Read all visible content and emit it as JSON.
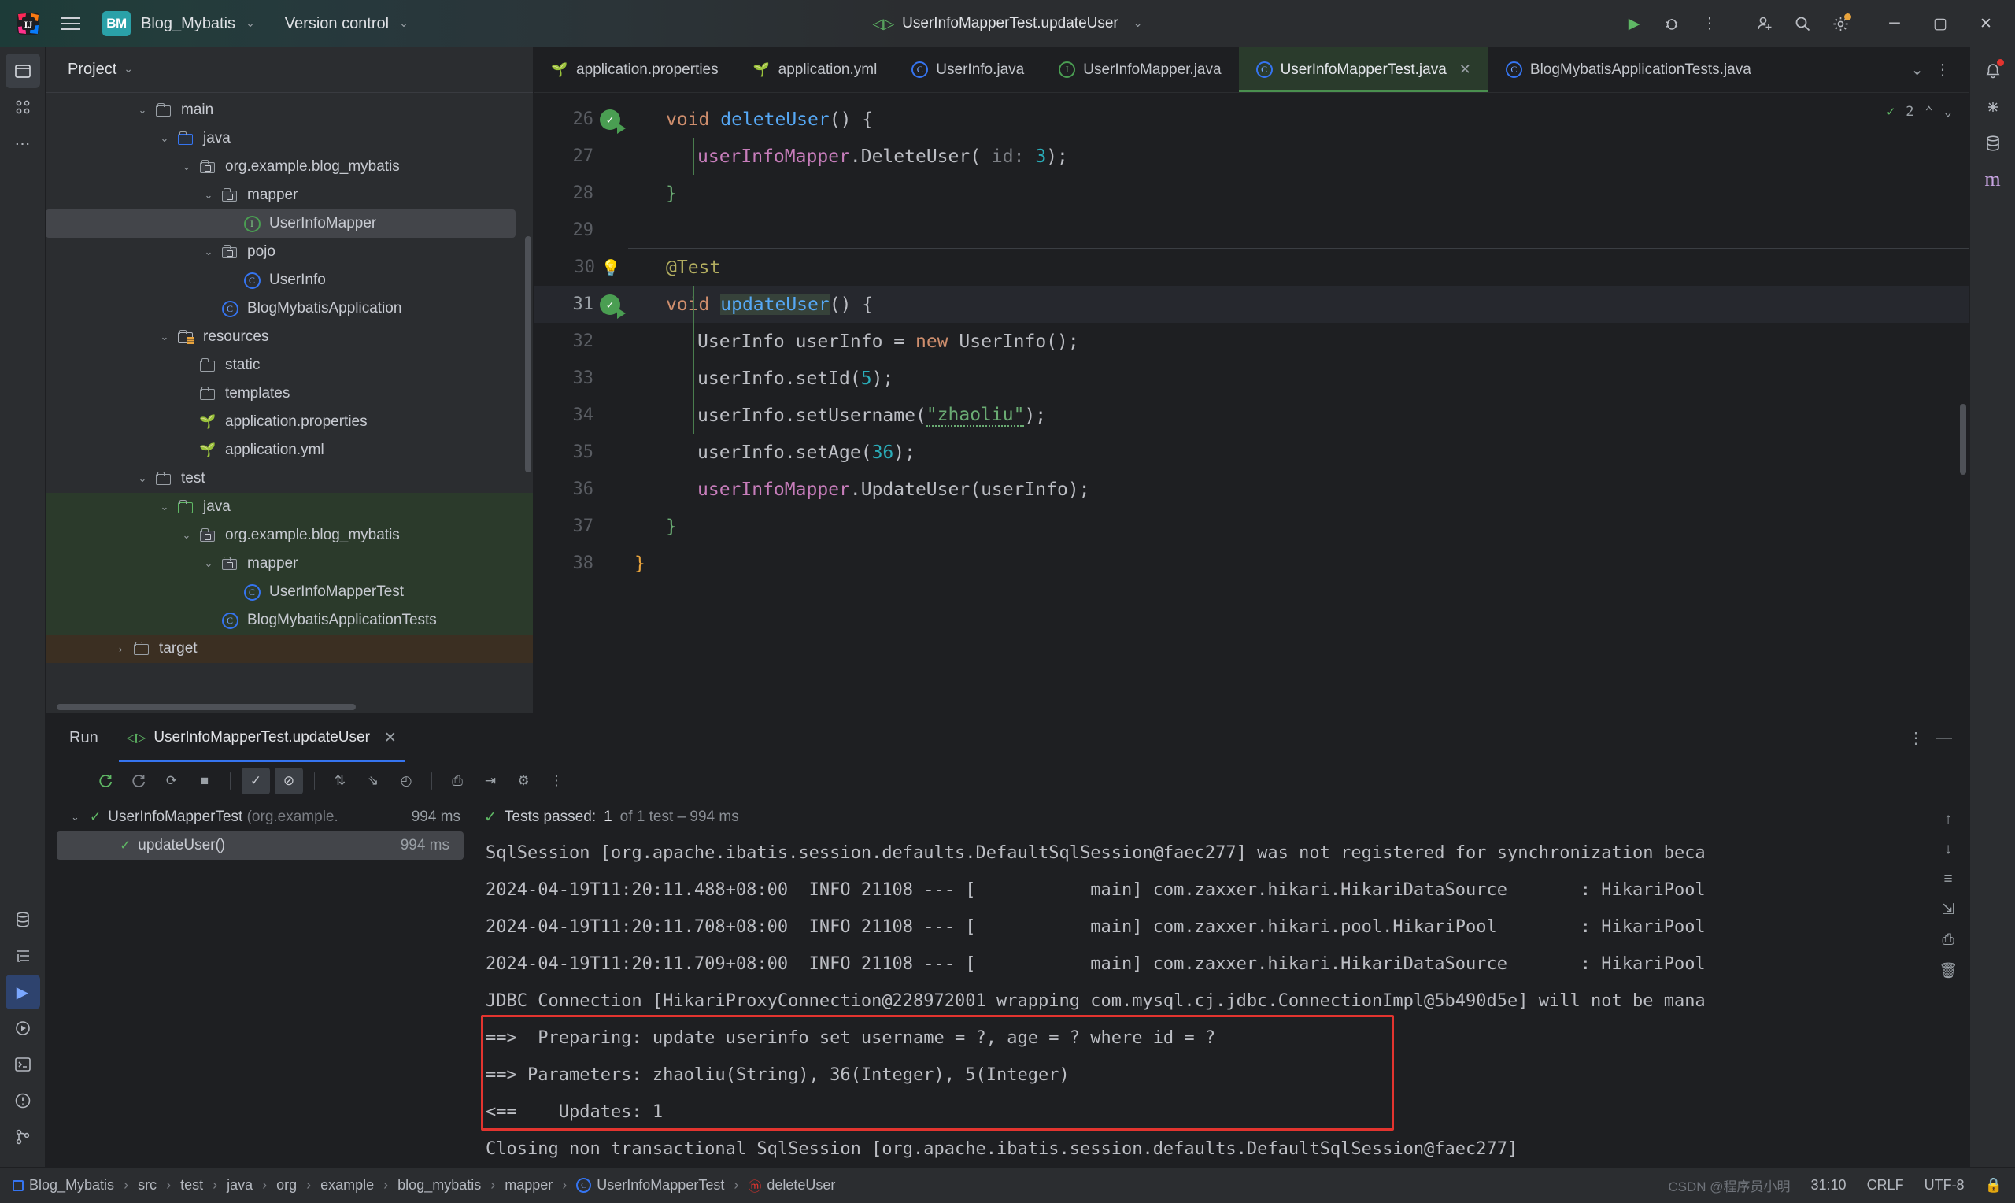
{
  "titlebar": {
    "project_badge": "BM",
    "project_name": "Blog_Mybatis",
    "vcs_label": "Version control",
    "run_config": "UserInfoMapperTest.updateUser",
    "icons": {
      "menu": "hamburger-icon",
      "run": "run-icon",
      "debug": "debug-icon",
      "more": "more-icon",
      "account": "account-icon",
      "search": "search-icon",
      "settings": "settings-icon",
      "minimize": "minimize-icon",
      "maximize": "maximize-icon",
      "close": "close-icon"
    }
  },
  "project_panel": {
    "title": "Project",
    "tree": [
      {
        "label": "main",
        "depth": 3,
        "icon": "folder",
        "twisty": "down"
      },
      {
        "label": "java",
        "depth": 4,
        "icon": "folder-blue",
        "twisty": "down"
      },
      {
        "label": "org.example.blog_mybatis",
        "depth": 5,
        "icon": "package",
        "twisty": "down"
      },
      {
        "label": "mapper",
        "depth": 6,
        "icon": "package",
        "twisty": "down"
      },
      {
        "label": "UserInfoMapper",
        "depth": 7,
        "icon": "interface",
        "selected": true
      },
      {
        "label": "pojo",
        "depth": 6,
        "icon": "package",
        "twisty": "down"
      },
      {
        "label": "UserInfo",
        "depth": 7,
        "icon": "class"
      },
      {
        "label": "BlogMybatisApplication",
        "depth": 6,
        "icon": "spring-boot"
      },
      {
        "label": "resources",
        "depth": 4,
        "icon": "folder-resources",
        "twisty": "down"
      },
      {
        "label": "static",
        "depth": 5,
        "icon": "folder"
      },
      {
        "label": "templates",
        "depth": 5,
        "icon": "folder"
      },
      {
        "label": "application.properties",
        "depth": 5,
        "icon": "spring-leaf"
      },
      {
        "label": "application.yml",
        "depth": 5,
        "icon": "spring-leaf"
      },
      {
        "label": "test",
        "depth": 3,
        "icon": "folder",
        "twisty": "down"
      },
      {
        "label": "java",
        "depth": 4,
        "icon": "folder-green",
        "twisty": "down",
        "green": true
      },
      {
        "label": "org.example.blog_mybatis",
        "depth": 5,
        "icon": "package",
        "twisty": "down",
        "green": true
      },
      {
        "label": "mapper",
        "depth": 6,
        "icon": "package",
        "twisty": "down",
        "green": true
      },
      {
        "label": "UserInfoMapperTest",
        "depth": 7,
        "icon": "class",
        "green": true
      },
      {
        "label": "BlogMybatisApplicationTests",
        "depth": 6,
        "icon": "class",
        "green": true
      },
      {
        "label": "target",
        "depth": 2,
        "icon": "folder-target",
        "twisty": "right",
        "brown": true
      }
    ]
  },
  "editor": {
    "tabs": [
      {
        "label": "application.properties",
        "icon": "spring-leaf-icon",
        "active": false
      },
      {
        "label": "application.yml",
        "icon": "spring-leaf-icon",
        "active": false
      },
      {
        "label": "UserInfo.java",
        "icon": "class-icon",
        "active": false
      },
      {
        "label": "UserInfoMapper.java",
        "icon": "interface-icon",
        "active": false
      },
      {
        "label": "UserInfoMapperTest.java",
        "icon": "class-icon",
        "active": true,
        "closable": true
      },
      {
        "label": "BlogMybatisApplicationTests.java",
        "icon": "class-icon",
        "active": false
      }
    ],
    "inspection_count": "2",
    "lines": [
      {
        "num": "26",
        "marker": "run-ok",
        "indent": 1
      },
      {
        "num": "27",
        "indent": 2
      },
      {
        "num": "28",
        "indent": 1
      },
      {
        "num": "29",
        "indent": 0
      },
      {
        "num": "30",
        "marker": "bulb",
        "indent": 1
      },
      {
        "num": "31",
        "marker": "run-ok",
        "indent": 1,
        "current": true
      },
      {
        "num": "32",
        "indent": 2
      },
      {
        "num": "33",
        "indent": 2
      },
      {
        "num": "34",
        "indent": 2
      },
      {
        "num": "35",
        "indent": 2
      },
      {
        "num": "36",
        "indent": 2
      },
      {
        "num": "37",
        "indent": 1
      },
      {
        "num": "38",
        "indent": 0
      }
    ],
    "code": {
      "l26_kw": "void",
      "l26_m": "deleteUser",
      "l26_tail": "() {",
      "l27_obj": "userInfoMapper",
      "l27_dot": ".",
      "l27_m": "DeleteUser",
      "l27_open": "( ",
      "l27_hint": "id:",
      "l27_num": "3",
      "l27_close": ");",
      "l28": "}",
      "l30": "@Test",
      "l31_kw": "void",
      "l31_m": "updateUser",
      "l31_tail": "() {",
      "l32_t": "UserInfo",
      "l32_v": "userInfo",
      "l32_eq": "= ",
      "l32_new": "new",
      "l32_c": "UserInfo",
      "l32_tail": "();",
      "l33_o": "userInfo",
      "l33_m": ".setId",
      "l33_o2": "(",
      "l33_n": "5",
      "l33_c": ");",
      "l34_o": "userInfo",
      "l34_m": ".setUsername",
      "l34_o2": "(",
      "l34_s": "\"zhaoliu\"",
      "l34_c": ");",
      "l35_o": "userInfo",
      "l35_m": ".setAge",
      "l35_o2": "(",
      "l35_n": "36",
      "l35_c": ");",
      "l36_o": "userInfoMapper",
      "l36_m": ".UpdateUser",
      "l36_o2": "(",
      "l36_a": "userInfo",
      "l36_c": ");",
      "l37": "}",
      "l38": "}"
    }
  },
  "run_panel": {
    "title": "Run",
    "tab_label": "UserInfoMapperTest.updateUser",
    "tests": [
      {
        "label": "UserInfoMapperTest",
        "package": "(org.example.",
        "time": "994 ms",
        "depth": 0,
        "twisty": true
      },
      {
        "label": "updateUser()",
        "time": "994 ms",
        "depth": 1,
        "selected": true
      }
    ],
    "status_prefix": "Tests passed:",
    "status_count": "1",
    "status_suffix": "of 1 test – 994 ms",
    "console_lines": [
      "SqlSession [org.apache.ibatis.session.defaults.DefaultSqlSession@faec277] was not registered for synchronization beca",
      "2024-04-19T11:20:11.488+08:00  INFO 21108 --- [           main] com.zaxxer.hikari.HikariDataSource       : HikariPool",
      "2024-04-19T11:20:11.708+08:00  INFO 21108 --- [           main] com.zaxxer.hikari.pool.HikariPool        : HikariPool",
      "2024-04-19T11:20:11.709+08:00  INFO 21108 --- [           main] com.zaxxer.hikari.HikariDataSource       : HikariPool",
      "JDBC Connection [HikariProxyConnection@228972001 wrapping com.mysql.cj.jdbc.ConnectionImpl@5b490d5e] will not be mana",
      "==>  Preparing: update userinfo set username = ?, age = ? where id = ?",
      "==> Parameters: zhaoliu(String), 36(Integer), 5(Integer)",
      "<==    Updates: 1",
      "Closing non transactional SqlSession [org.apache.ibatis.session.defaults.DefaultSqlSession@faec277]"
    ],
    "highlight_color": "#e3342f"
  },
  "statusbar": {
    "breadcrumb": [
      "Blog_Mybatis",
      "src",
      "test",
      "java",
      "org",
      "example",
      "blog_mybatis",
      "mapper",
      "UserInfoMapperTest",
      "deleteUser"
    ],
    "caret": "31:10",
    "line_sep": "CRLF",
    "encoding": "UTF-8",
    "watermark": "CSDN @程序员小明"
  }
}
